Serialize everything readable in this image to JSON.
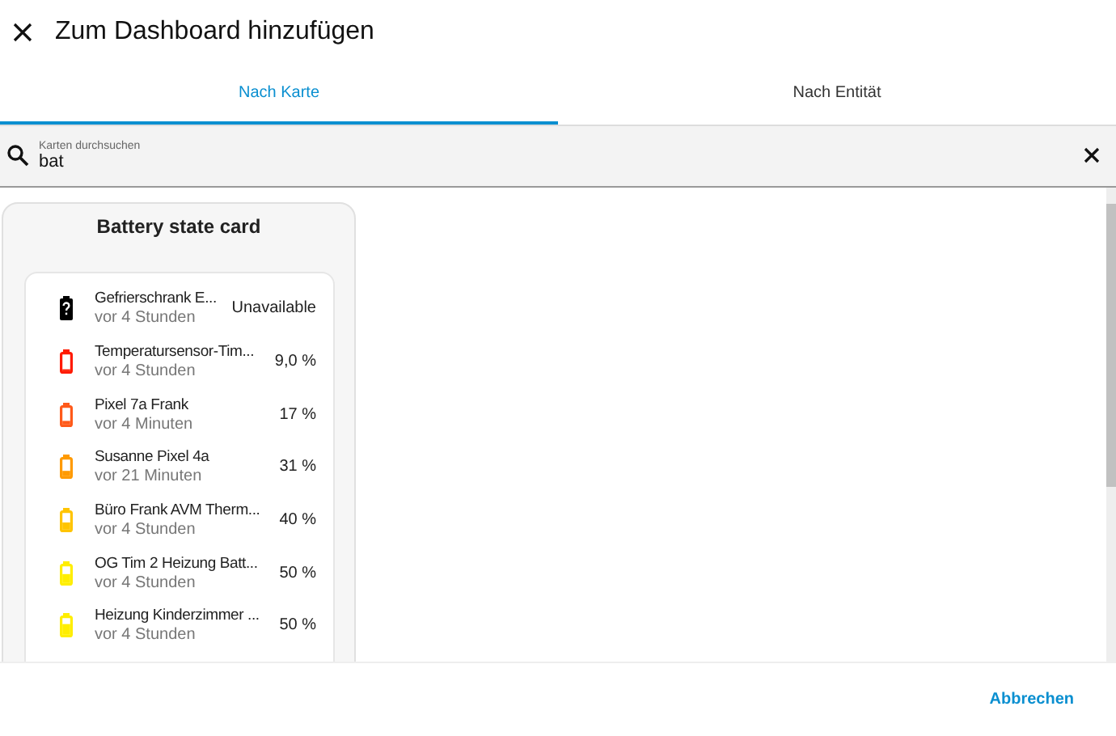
{
  "dialog": {
    "title": "Zum Dashboard hinzufügen"
  },
  "tabs": [
    {
      "label": "Nach Karte",
      "selected": true
    },
    {
      "label": "Nach Entität",
      "selected": false
    }
  ],
  "search": {
    "placeholder": "Karten durchsuchen",
    "value": "bat"
  },
  "card": {
    "title": "Battery state card",
    "entities": [
      {
        "kind": "unknown",
        "name": "Gefrierschrank E...",
        "time": "vor 4 Stunden",
        "state": "Unavailable",
        "color": "#000000"
      },
      {
        "kind": "battery",
        "name": "Temperatursensor-Tim...",
        "time": "vor 4 Stunden",
        "state": "9,0 %",
        "color": "#ff1a00"
      },
      {
        "kind": "battery",
        "name": "Pixel 7a Frank",
        "time": "vor 4 Minuten",
        "state": "17 %",
        "color": "#ff5a1a"
      },
      {
        "kind": "battery",
        "name": "Susanne Pixel 4a",
        "time": "vor 21 Minuten",
        "state": "31 %",
        "color": "#ff9a00"
      },
      {
        "kind": "battery",
        "name": "Büro Frank AVM Therm...",
        "time": "vor 4 Stunden",
        "state": "40 %",
        "color": "#ffc400"
      },
      {
        "kind": "battery",
        "name": "OG Tim 2 Heizung Batt...",
        "time": "vor 4 Stunden",
        "state": "50 %",
        "color": "#ffee00"
      },
      {
        "kind": "battery",
        "name": "Heizung Kinderzimmer ...",
        "time": "vor 4 Stunden",
        "state": "50 %",
        "color": "#ffee00"
      }
    ]
  },
  "buttons": [
    {
      "label": "Abbrechen"
    }
  ]
}
